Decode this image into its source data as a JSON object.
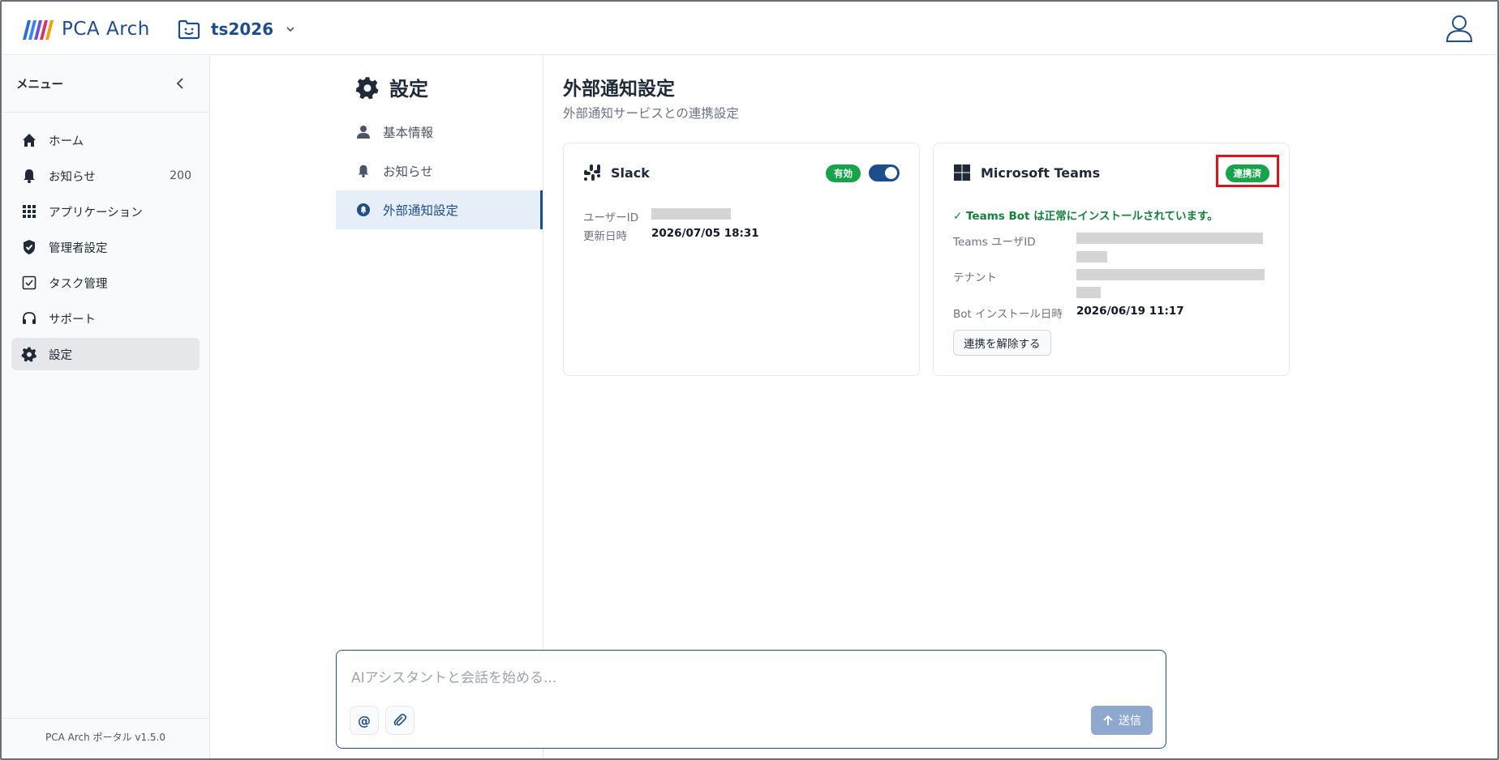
{
  "app": {
    "brand": "PCA Arch",
    "workspace": "ts2026"
  },
  "colors": {
    "brand": "#1e4d8c",
    "success": "#16a34a",
    "highlight": "#e3111b"
  },
  "sidebar": {
    "title": "メニュー",
    "items": [
      {
        "label": "ホーム",
        "icon": "home-icon"
      },
      {
        "label": "お知らせ",
        "icon": "bell-icon",
        "count": "200"
      },
      {
        "label": "アプリケーション",
        "icon": "grid-icon"
      },
      {
        "label": "管理者設定",
        "icon": "shield-icon"
      },
      {
        "label": "タスク管理",
        "icon": "checkbox-icon"
      },
      {
        "label": "サポート",
        "icon": "headset-icon"
      },
      {
        "label": "設定",
        "icon": "gear-icon",
        "active": true
      }
    ],
    "footer": "PCA Arch ポータル v1.5.0"
  },
  "settings": {
    "title": "設定",
    "nav": [
      {
        "label": "基本情報",
        "icon": "user-icon"
      },
      {
        "label": "お知らせ",
        "icon": "bell-icon"
      },
      {
        "label": "外部通知設定",
        "icon": "notification-icon",
        "active": true
      }
    ]
  },
  "content": {
    "title": "外部通知設定",
    "subtitle": "外部通知サービスとの連携設定",
    "slack": {
      "name": "Slack",
      "badge": "有効",
      "enabled": true,
      "user_id_label": "ユーザーID",
      "updated_label": "更新日時",
      "updated_value": "2026/07/05 18:31"
    },
    "teams": {
      "name": "Microsoft Teams",
      "badge": "連携済",
      "status_message": "✓ Teams Bot は正常にインストールされています。",
      "user_id_label": "Teams ユーザID",
      "tenant_label": "テナント",
      "bot_installed_label": "Bot インストール日時",
      "bot_installed_value": "2026/06/19 11:17",
      "disconnect_label": "連携を解除する"
    }
  },
  "chat": {
    "placeholder": "AIアシスタントと会話を始める...",
    "send_label": "送信"
  }
}
